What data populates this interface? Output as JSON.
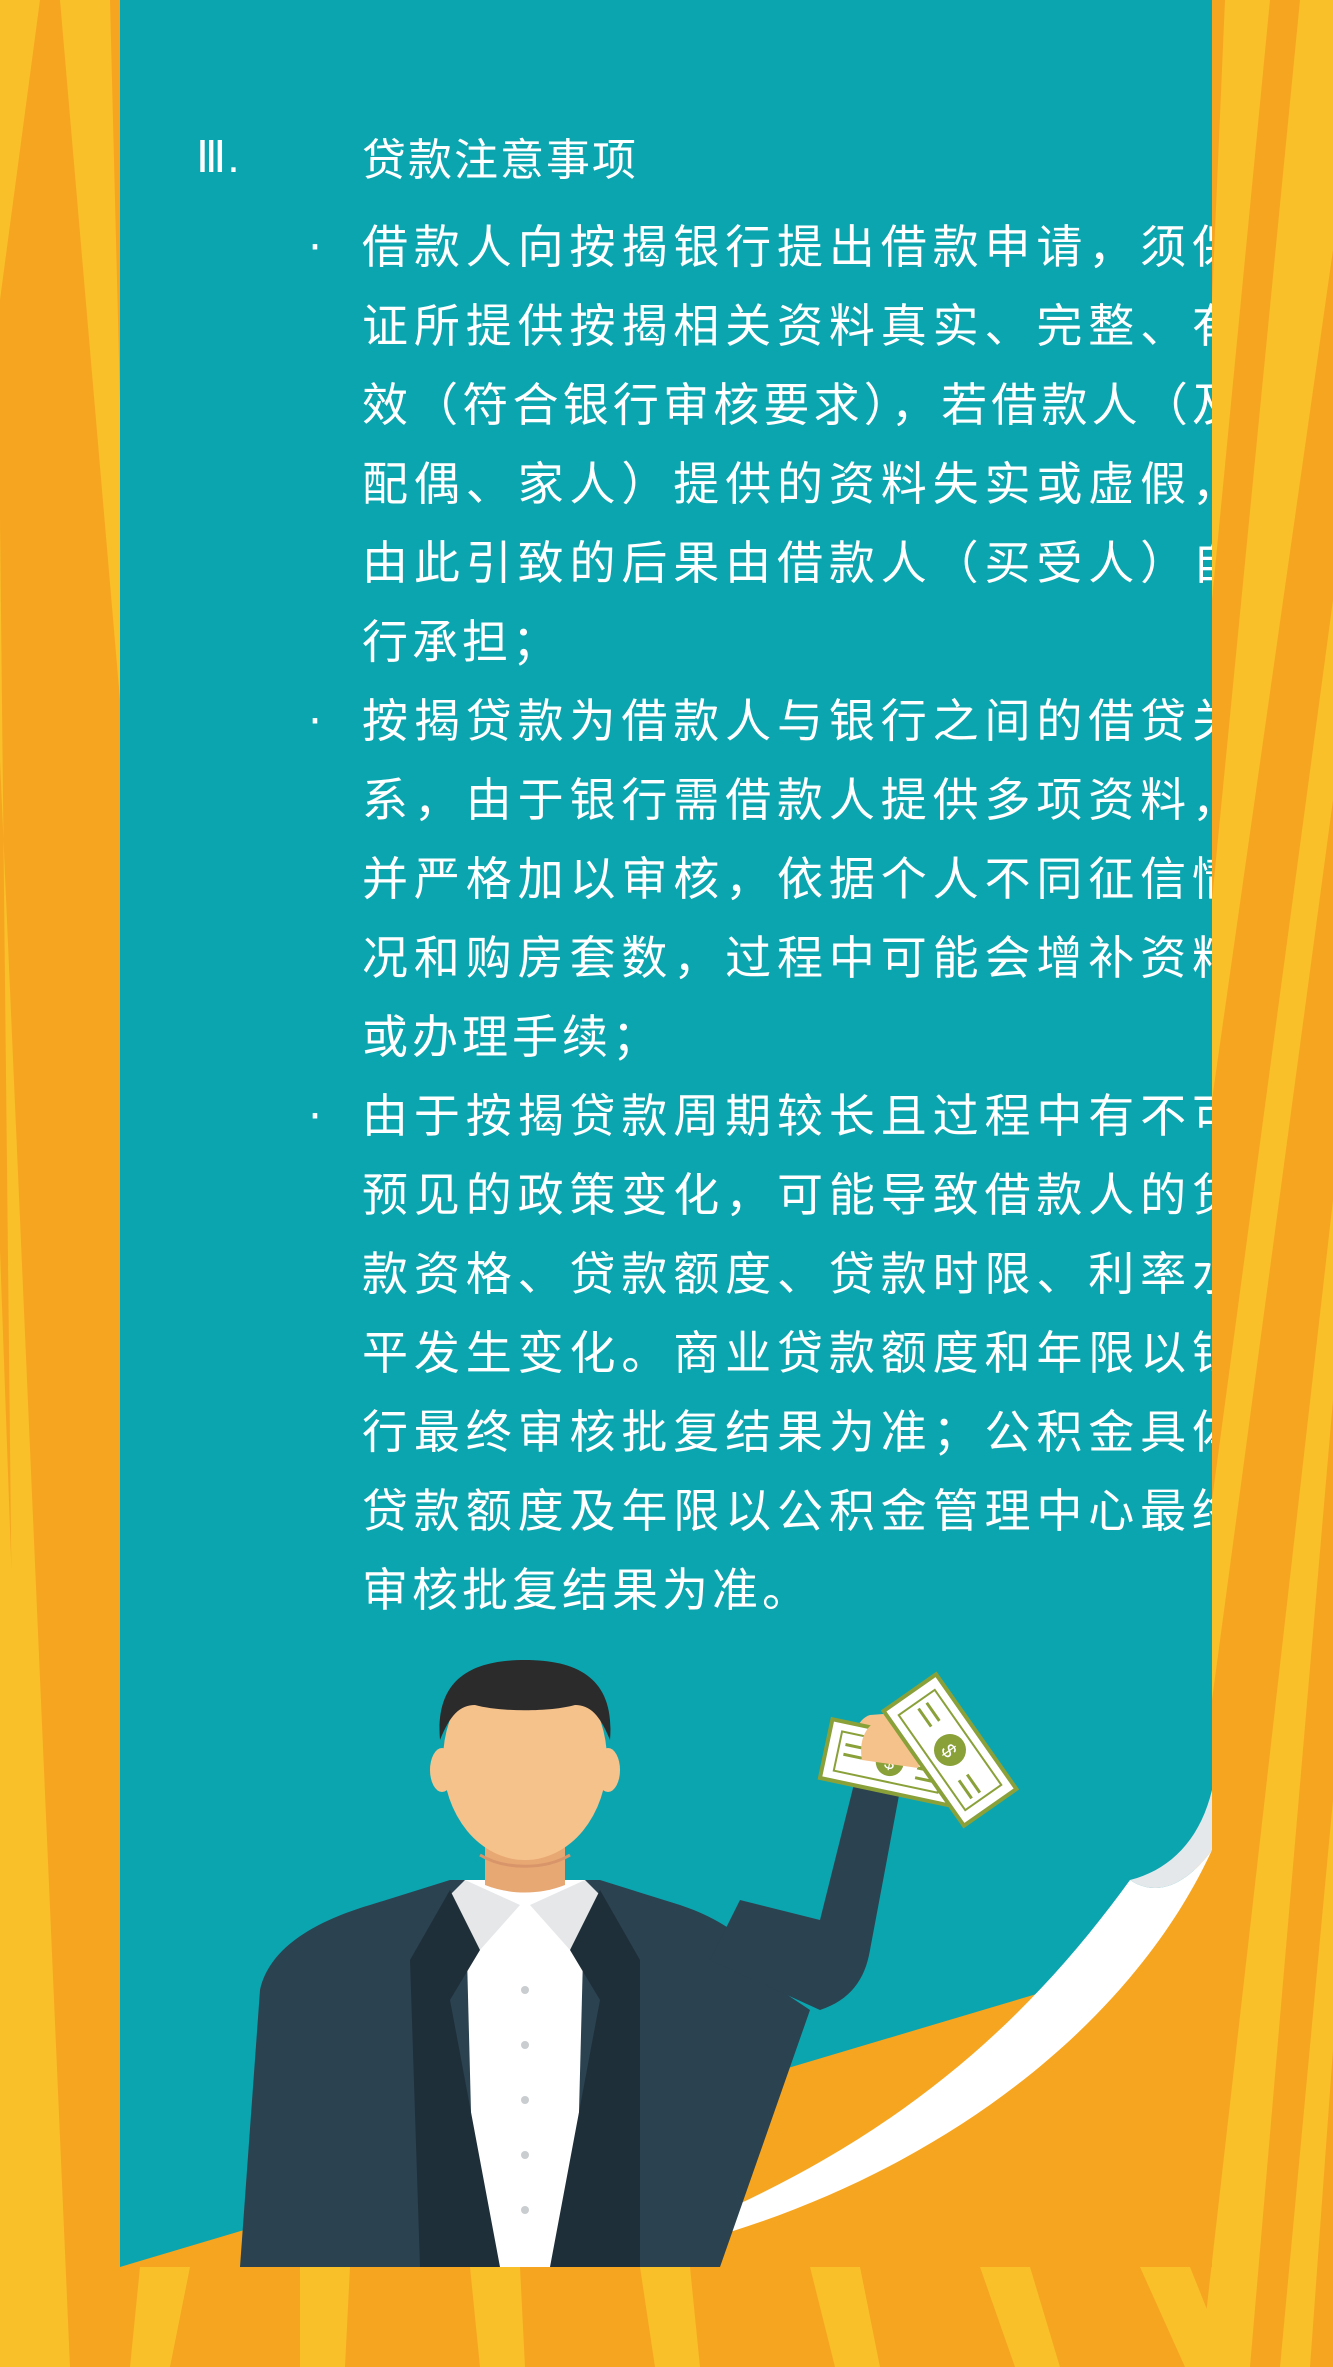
{
  "section": {
    "number": "Ⅲ.",
    "title": "贷款注意事项"
  },
  "items": [
    {
      "bullet": "·",
      "text": "借款人向按揭银行提出借款申请，须保证所提供按揭相关资料真实、完整、有效（符合银行审核要求），若借款人（及配偶、家人）提供的资料失实或虚假，由此引致的后果由借款人（买受人）自行承担；"
    },
    {
      "bullet": "·",
      "text": "按揭贷款为借款人与银行之间的借贷关系，由于银行需借款人提供多项资料，并严格加以审核，依据个人不同征信情况和购房套数，过程中可能会增补资料或办理手续；"
    },
    {
      "bullet": "·",
      "text": "由于按揭贷款周期较长且过程中有不可预见的政策变化，可能导致借款人的贷款资格、贷款额度、贷款时限、利率水平发生变化。商业贷款额度和年限以银行最终审核批复结果为准；公积金具体贷款额度及年限以公积金管理中心最终审核批复结果为准。"
    }
  ],
  "colors": {
    "background_orange": "#F6A520",
    "stripe_yellow": "#F9C02A",
    "card_teal": "#0BA5AF",
    "text_white": "#FFFFFF",
    "suit_dark": "#2B4250",
    "skin": "#F6C28C",
    "hair": "#2B2B2B",
    "money_green": "#8AA13A"
  },
  "illustration": {
    "figure": "businessman-holding-money-icon",
    "money_symbol": "$"
  }
}
